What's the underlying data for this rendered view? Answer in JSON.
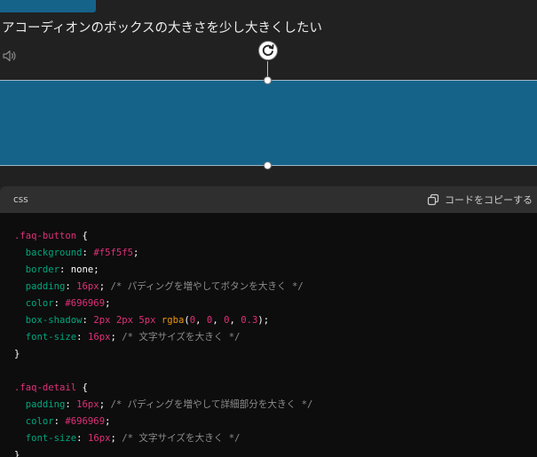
{
  "message": {
    "text": "アコーディオンのボックスの大きさを少し大きくしたい"
  },
  "code_block": {
    "language": "css",
    "copy_label": "コードをコピーする",
    "lines": [
      [
        {
          "t": ".faq-button",
          "c": "sel"
        },
        {
          "t": " {",
          "c": "pun"
        }
      ],
      [
        {
          "t": "  background",
          "c": "prop"
        },
        {
          "t": ": ",
          "c": "pun"
        },
        {
          "t": "#f5f5f5",
          "c": "val"
        },
        {
          "t": ";",
          "c": "pun"
        }
      ],
      [
        {
          "t": "  border",
          "c": "prop"
        },
        {
          "t": ": none;",
          "c": "pun"
        }
      ],
      [
        {
          "t": "  padding",
          "c": "prop"
        },
        {
          "t": ": ",
          "c": "pun"
        },
        {
          "t": "16px",
          "c": "val"
        },
        {
          "t": "; ",
          "c": "pun"
        },
        {
          "t": "/* パディングを増やしてボタンを大きく */",
          "c": "cmt"
        }
      ],
      [
        {
          "t": "  color",
          "c": "prop"
        },
        {
          "t": ": ",
          "c": "pun"
        },
        {
          "t": "#696969",
          "c": "val"
        },
        {
          "t": ";",
          "c": "pun"
        }
      ],
      [
        {
          "t": "  box-shadow",
          "c": "prop"
        },
        {
          "t": ": ",
          "c": "pun"
        },
        {
          "t": "2px 2px 5px ",
          "c": "val"
        },
        {
          "t": "rgba",
          "c": "fn"
        },
        {
          "t": "(",
          "c": "pun"
        },
        {
          "t": "0",
          "c": "val"
        },
        {
          "t": ", ",
          "c": "pun"
        },
        {
          "t": "0",
          "c": "val"
        },
        {
          "t": ", ",
          "c": "pun"
        },
        {
          "t": "0",
          "c": "val"
        },
        {
          "t": ", ",
          "c": "pun"
        },
        {
          "t": "0.3",
          "c": "val"
        },
        {
          "t": ");",
          "c": "pun"
        }
      ],
      [
        {
          "t": "  font-size",
          "c": "prop"
        },
        {
          "t": ": ",
          "c": "pun"
        },
        {
          "t": "16px",
          "c": "val"
        },
        {
          "t": "; ",
          "c": "pun"
        },
        {
          "t": "/* 文字サイズを大きく */",
          "c": "cmt"
        }
      ],
      [
        {
          "t": "}",
          "c": "pun"
        }
      ],
      [],
      [
        {
          "t": ".faq-detail",
          "c": "sel"
        },
        {
          "t": " {",
          "c": "pun"
        }
      ],
      [
        {
          "t": "  padding",
          "c": "prop"
        },
        {
          "t": ": ",
          "c": "pun"
        },
        {
          "t": "16px",
          "c": "val"
        },
        {
          "t": "; ",
          "c": "pun"
        },
        {
          "t": "/* パディングを増やして詳細部分を大きく */",
          "c": "cmt"
        }
      ],
      [
        {
          "t": "  color",
          "c": "prop"
        },
        {
          "t": ": ",
          "c": "pun"
        },
        {
          "t": "#696969",
          "c": "val"
        },
        {
          "t": ";",
          "c": "pun"
        }
      ],
      [
        {
          "t": "  font-size",
          "c": "prop"
        },
        {
          "t": ": ",
          "c": "pun"
        },
        {
          "t": "16px",
          "c": "val"
        },
        {
          "t": "; ",
          "c": "pun"
        },
        {
          "t": "/* 文字サイズを大きく */",
          "c": "cmt"
        }
      ],
      [
        {
          "t": "}",
          "c": "pun"
        }
      ]
    ]
  },
  "icons": {
    "speaker": "speaker-icon",
    "rotate": "rotate-icon",
    "copy": "copy-icon"
  },
  "colors": {
    "page_bg": "#212121",
    "box_fill": "#16638a",
    "code_bg": "#0d0d0d",
    "code_header_bg": "#2f2f2f",
    "selector": "#df3079",
    "property": "#00a67d",
    "value": "#df3079",
    "function": "#e9950c",
    "comment": "#8c8c8c"
  }
}
